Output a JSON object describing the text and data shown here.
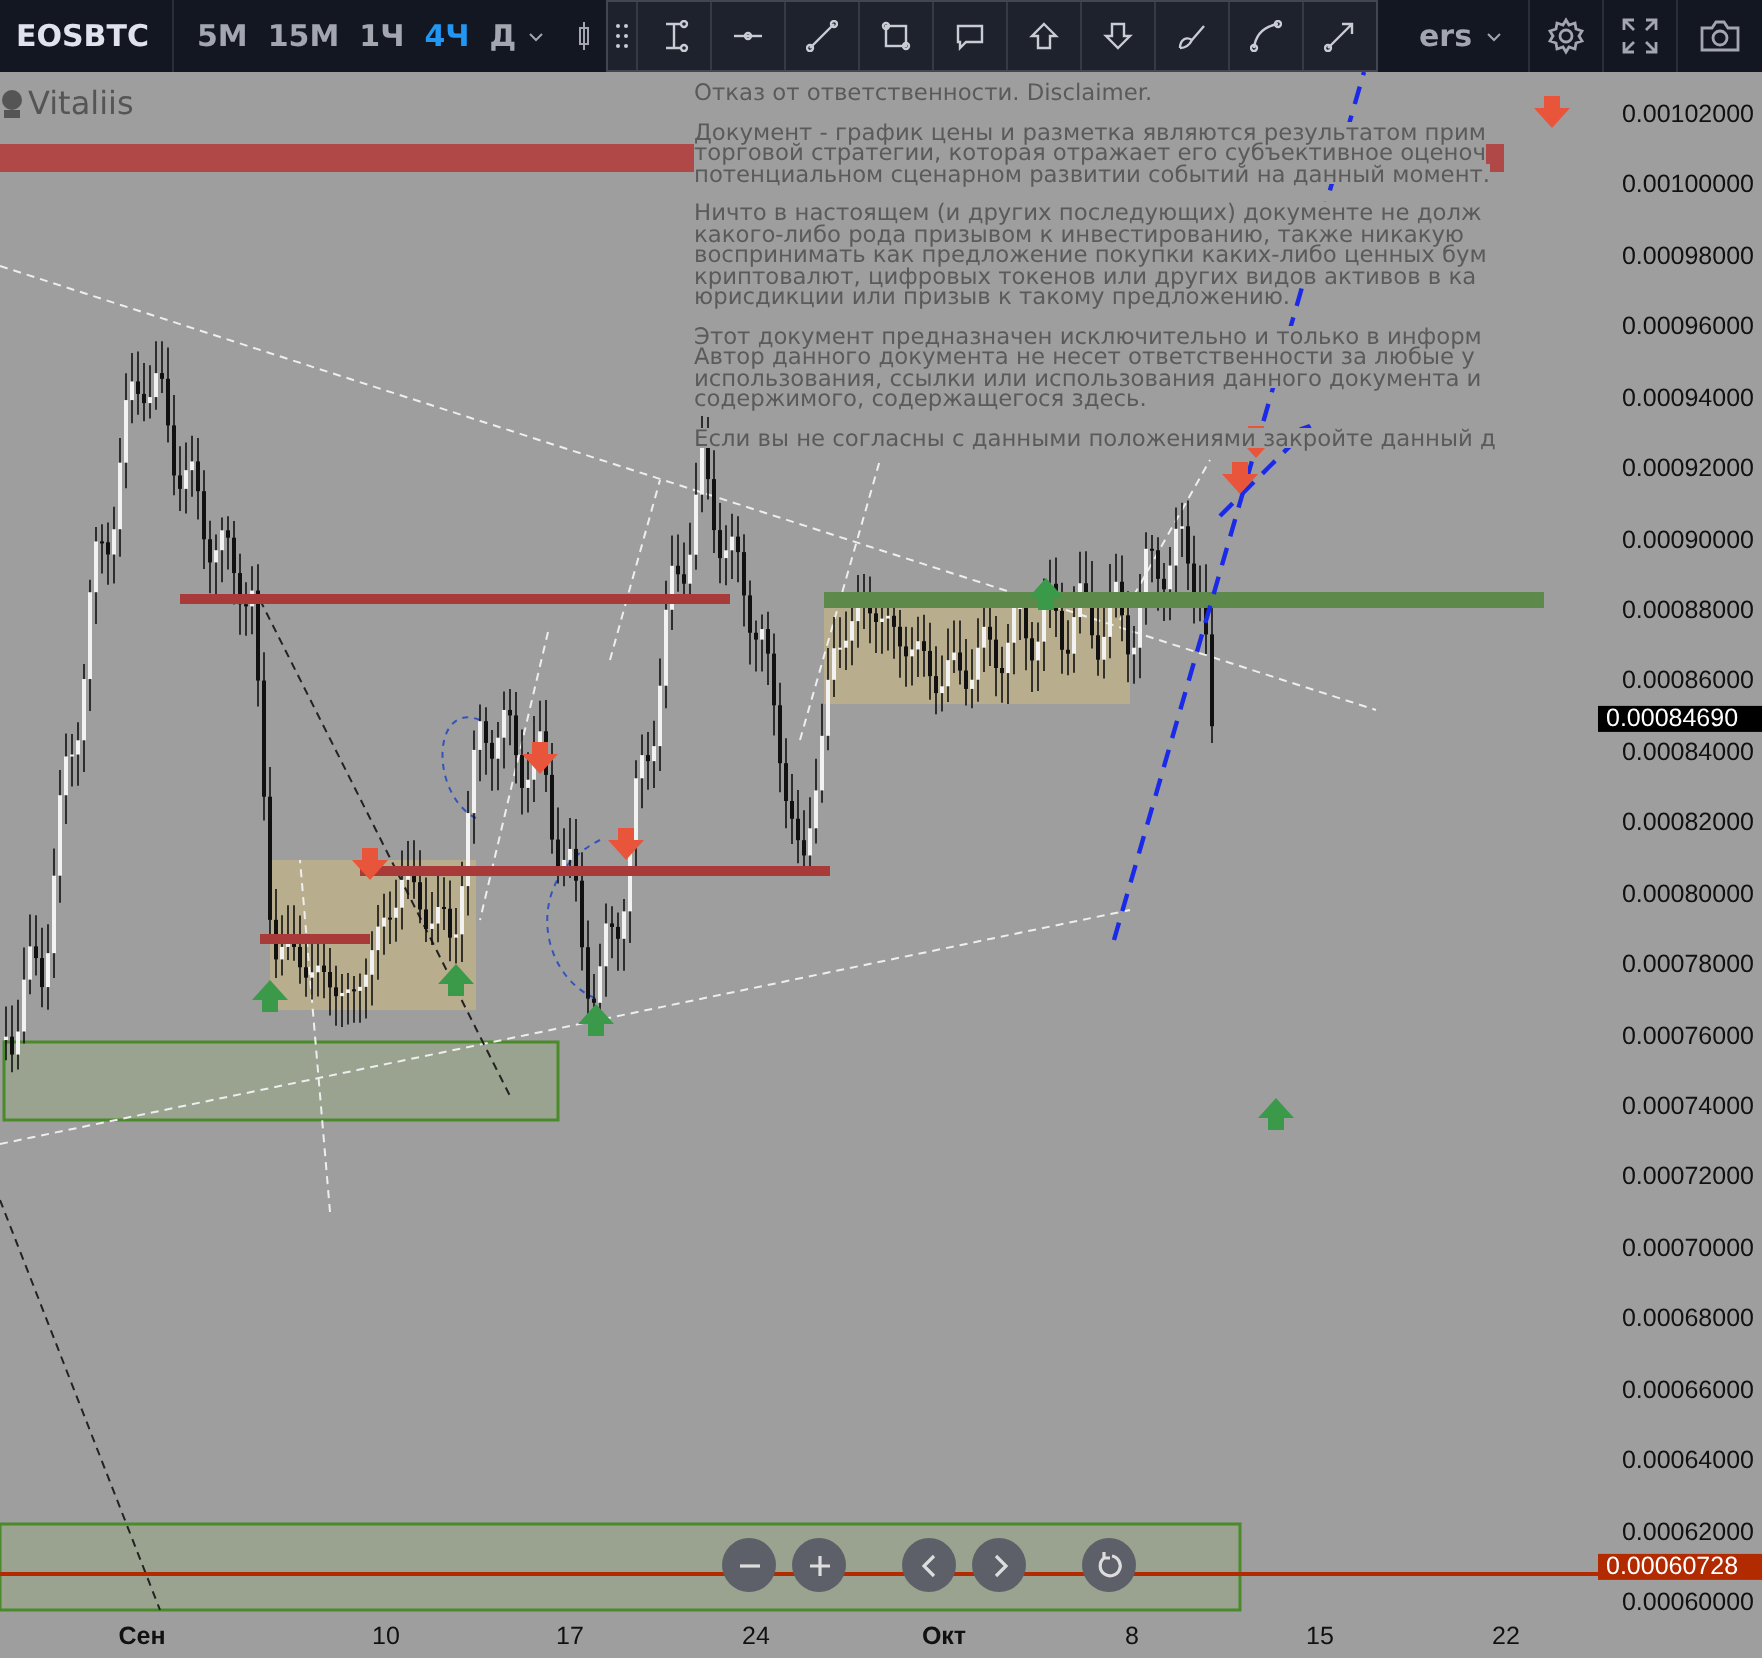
{
  "toolbar": {
    "symbol": "EOSBTC",
    "intervals": [
      {
        "label": "5M",
        "selected": false
      },
      {
        "label": "15M",
        "selected": false
      },
      {
        "label": "1Ч",
        "selected": false
      },
      {
        "label": "4Ч",
        "selected": true
      },
      {
        "label": "Д",
        "selected": false
      }
    ],
    "indicators_label": "ers"
  },
  "author": "Vitaliis",
  "disclaimer": {
    "paragraphs": [
      [
        "Отказ от ответственности. Disclaimer."
      ],
      [
        "Документ - график цены и разметка являются результатом прим",
        "торговой стратегии, которая отражает его субъективное оценоч",
        "потенциальном сценарном развитии событий на данный момент."
      ],
      [
        "Ничто в настоящем (и других последующих) документе не долж",
        "какого-либо рода призывом к инвестированию, также никакую",
        "воспринимать как предложение покупки каких-либо ценных бум",
        "криптовалют, цифровых токенов или других видов активов в ка",
        "юрисдикции или призыв к такому предложению."
      ],
      [
        "Этот документ предназначен исключительно и только в информ",
        "Автор данного документа не несет ответственности за любые у",
        "использования, ссылки или использования данного документа и",
        "содержимого, содержащегося здесь."
      ],
      [
        "Если вы не согласны с данными положениями закройте данный д"
      ]
    ]
  },
  "price_axis": {
    "ticks": [
      "0.00102000",
      "0.00100000",
      "0.00098000",
      "0.00096000",
      "0.00094000",
      "0.00092000",
      "0.00090000",
      "0.00088000",
      "0.00086000",
      "0.00084000",
      "0.00082000",
      "0.00080000",
      "0.00078000",
      "0.00076000",
      "0.00074000",
      "0.00072000",
      "0.00070000",
      "0.00068000",
      "0.00066000",
      "0.00064000",
      "0.00062000",
      "0.00060000"
    ],
    "tags": [
      {
        "label": "0.00084690",
        "color": "#000000"
      },
      {
        "label": "0.00060728",
        "color": "#b22a00"
      }
    ]
  },
  "time_axis": [
    {
      "label": "Сен",
      "kind": "month"
    },
    {
      "label": "10",
      "kind": "day"
    },
    {
      "label": "17",
      "kind": "day"
    },
    {
      "label": "24",
      "kind": "day"
    },
    {
      "label": "Окт",
      "kind": "month"
    },
    {
      "label": "8",
      "kind": "day"
    },
    {
      "label": "15",
      "kind": "day"
    },
    {
      "label": "22",
      "kind": "day"
    }
  ]
}
